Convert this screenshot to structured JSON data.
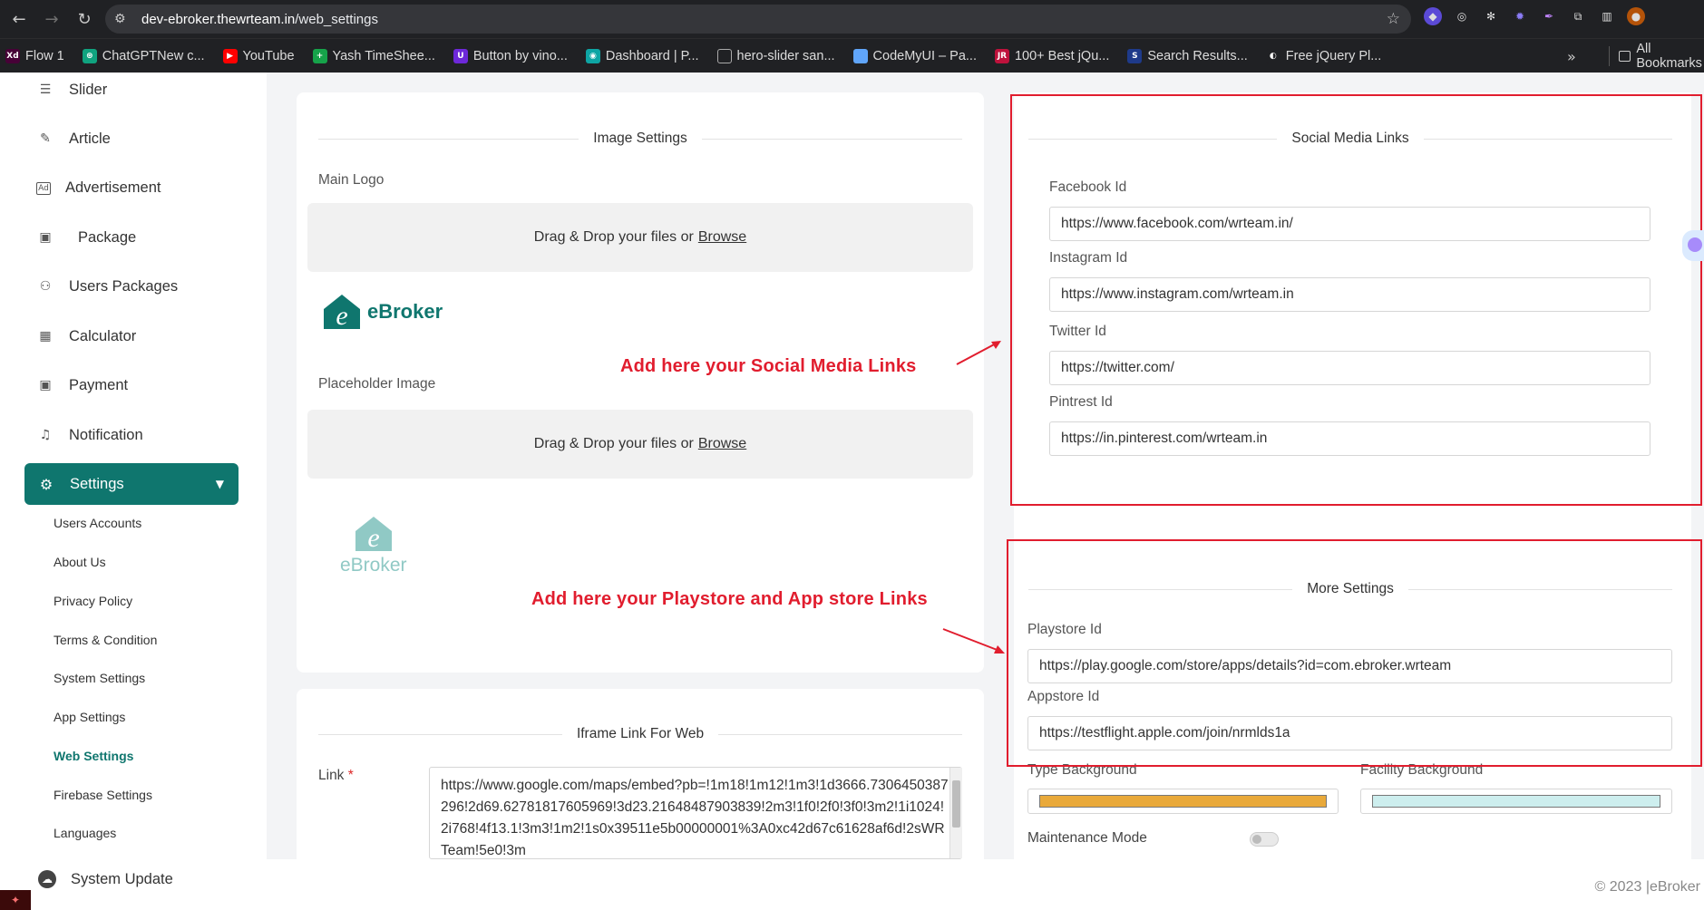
{
  "browser": {
    "url_domain": "dev-ebroker.thewrteam.in",
    "url_path": "/web_settings",
    "bookmarks": [
      {
        "label": "Flow 1",
        "color": "#470137",
        "glyph": "Xd"
      },
      {
        "label": "ChatGPTNew c...",
        "color": "#10a37f",
        "glyph": "⊛"
      },
      {
        "label": "YouTube",
        "color": "#ff0000",
        "glyph": "▶"
      },
      {
        "label": "Yash TimeShee...",
        "color": "#16a34a",
        "glyph": "+"
      },
      {
        "label": "Button by vino...",
        "color": "#6d28d9",
        "glyph": "U"
      },
      {
        "label": "Dashboard | P...",
        "color": "#0ea5a4",
        "glyph": "◉"
      },
      {
        "label": "hero-slider san...",
        "color": "#202124",
        "glyph": "▢"
      },
      {
        "label": "CodeMyUI – Pa...",
        "color": "#60a5fa",
        "glyph": "▦"
      },
      {
        "label": "100+ Best jQu...",
        "color": "#be123c",
        "glyph": "JR"
      },
      {
        "label": "Search Results...",
        "color": "#1e3a8a",
        "glyph": "S"
      },
      {
        "label": "Free jQuery Pl...",
        "color": "#202124",
        "glyph": "◐"
      }
    ],
    "all_bookmarks_label": "All Bookmarks"
  },
  "sidebar": {
    "items": [
      {
        "label": "Slider",
        "icon": "sliders-icon"
      },
      {
        "label": "Article",
        "icon": "pen-icon"
      },
      {
        "label": "Advertisement",
        "icon": "ad-icon"
      },
      {
        "label": "Package",
        "icon": "package-icon"
      },
      {
        "label": "Users Packages",
        "icon": "user-package-icon"
      },
      {
        "label": "Calculator",
        "icon": "calculator-icon"
      },
      {
        "label": "Payment",
        "icon": "payment-icon"
      },
      {
        "label": "Notification",
        "icon": "bell-icon"
      }
    ],
    "active": {
      "label": "Settings",
      "icon": "gear-icon"
    },
    "sub_items": [
      "Users Accounts",
      "About Us",
      "Privacy Policy",
      "Terms & Condition",
      "System Settings",
      "App Settings",
      "Web Settings",
      "Firebase Settings",
      "Languages"
    ],
    "active_sub": "Web Settings",
    "system_update": "System Update"
  },
  "image_settings": {
    "title": "Image Settings",
    "main_logo_label": "Main Logo",
    "dropzone_text": "Drag & Drop your files or",
    "browse_text": "Browse",
    "placeholder_label": "Placeholder Image",
    "logo_name": "eBroker"
  },
  "iframe": {
    "title": "Iframe Link For Web",
    "link_label": "Link",
    "required_mark": "*",
    "link_value": "https://www.google.com/maps/embed?pb=!1m18!1m12!1m3!1d3666.7306450387296!2d69.62781817605969!3d23.21648487903839!2m3!1f0!2f0!3f0!3m2!1i1024!2i768!4f13.1!3m3!1m2!1s0x39511e5b00000001%3A0xc42d67c61628af6d!2sWRTeam!5e0!3m"
  },
  "social": {
    "title": "Social Media Links",
    "fields": [
      {
        "label": "Facebook Id",
        "value": "https://www.facebook.com/wrteam.in/"
      },
      {
        "label": "Instagram Id",
        "value": "https://www.instagram.com/wrteam.in"
      },
      {
        "label": "Twitter Id",
        "value": "https://twitter.com/"
      },
      {
        "label": "Pintrest Id",
        "value": "https://in.pinterest.com/wrteam.in"
      }
    ]
  },
  "more_settings": {
    "title": "More Settings",
    "playstore_label": "Playstore Id",
    "playstore_value": "https://play.google.com/store/apps/details?id=com.ebroker.wrteam",
    "appstore_label": "Appstore Id",
    "appstore_value": "https://testflight.apple.com/join/nrmlds1a",
    "type_bg_label": "Type Background",
    "type_bg_color": "#e9a93a",
    "facility_bg_label": "Facility Background",
    "facility_bg_color": "#cdeeee",
    "maintenance_label": "Maintenance Mode"
  },
  "annotations": {
    "social_text": "Add here your Social Media Links",
    "store_text": "Add here your Playstore and App store Links",
    "color": "#e11d2e"
  },
  "footer": {
    "copyright": "© 2023 |eBroker"
  },
  "colors": {
    "primary": "#0f766e",
    "annotation": "#e11d2e"
  }
}
